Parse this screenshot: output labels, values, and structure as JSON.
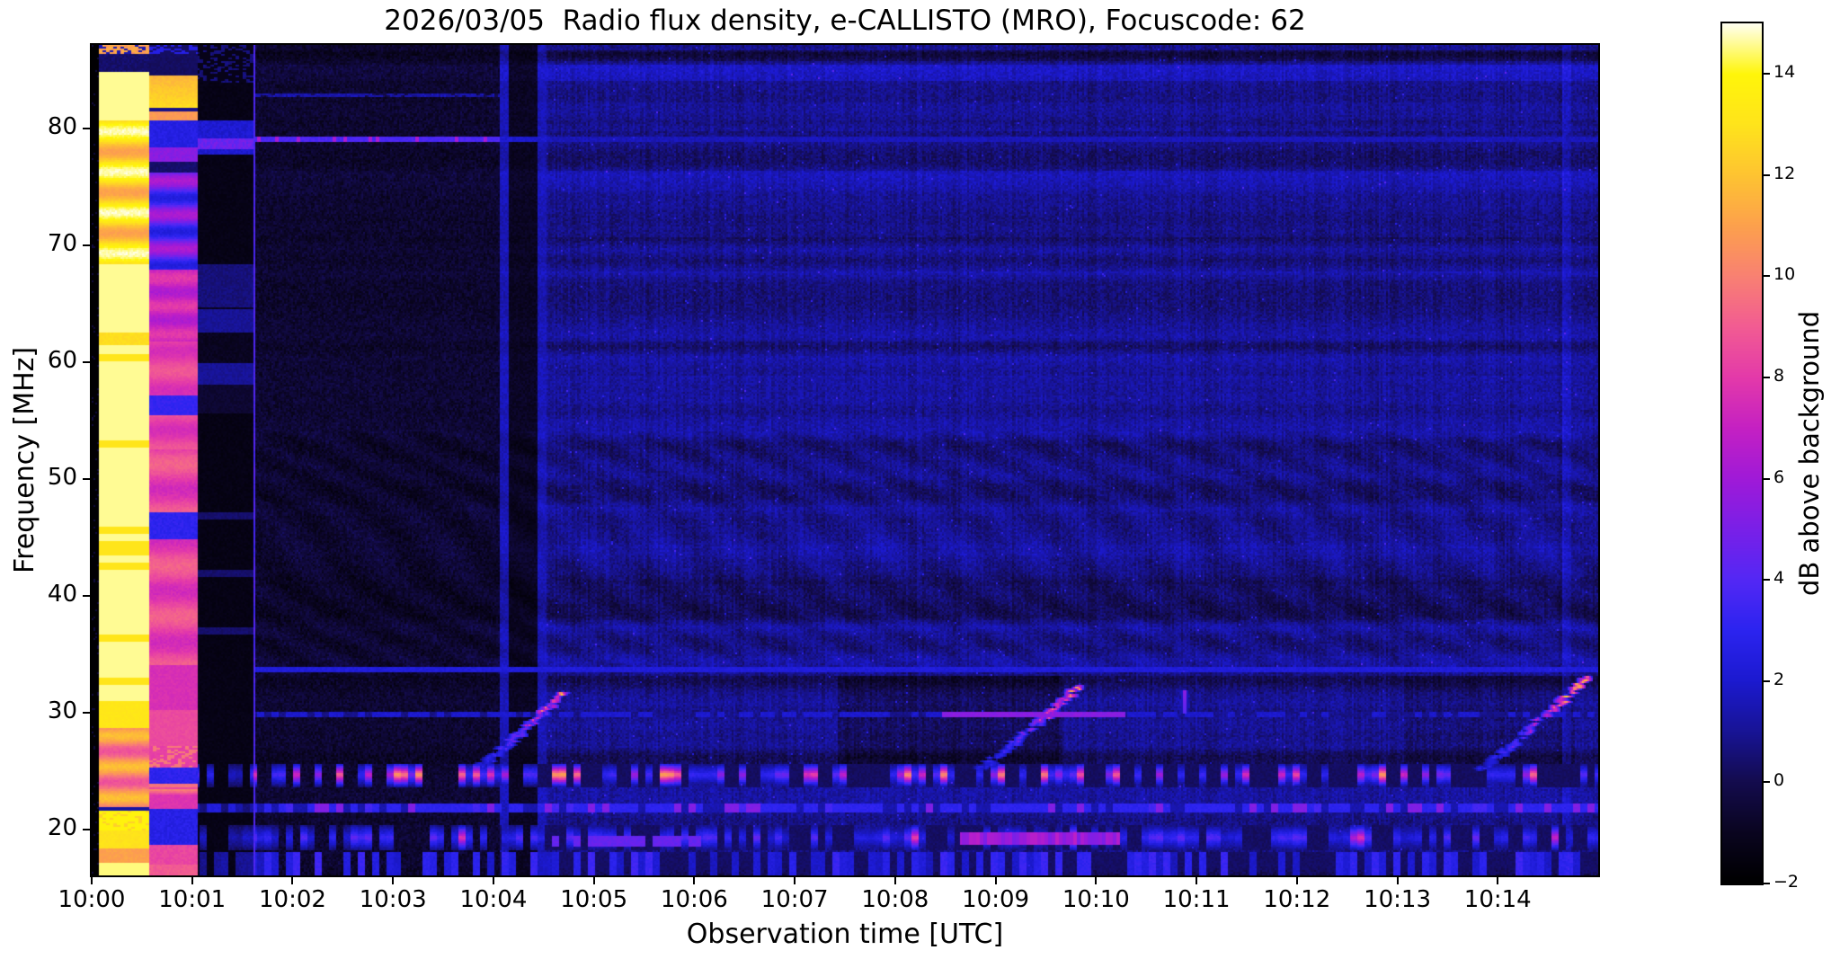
{
  "figure": {
    "background": "#ffffff"
  },
  "chart_data": {
    "type": "heatmap",
    "subtype": "solar-radio-spectrogram",
    "title": "2026/03/05  Radio flux density, e-CALLISTO (MRO), Focuscode: 62",
    "xlabel": "Observation time [UTC]",
    "ylabel": "Frequency [MHz]",
    "x_tick_labels": [
      "10:00",
      "10:01",
      "10:02",
      "10:03",
      "10:04",
      "10:05",
      "10:06",
      "10:07",
      "10:08",
      "10:09",
      "10:10",
      "10:11",
      "10:12",
      "10:13",
      "10:14"
    ],
    "x_range_utc": [
      "10:00:00",
      "10:15:00"
    ],
    "y_tick_labels": [
      "80",
      "70",
      "60",
      "50",
      "40",
      "30",
      "20"
    ],
    "y_tick_values": [
      80,
      70,
      60,
      50,
      40,
      30,
      20
    ],
    "y_range_mhz": [
      16.1,
      87.2
    ],
    "grid": false,
    "legend": "none",
    "colorbar": {
      "label": "dB above background",
      "tick_labels": [
        "14",
        "12",
        "10",
        "8",
        "6",
        "4",
        "2",
        "0",
        "−2"
      ],
      "tick_values": [
        14,
        12,
        10,
        8,
        6,
        4,
        2,
        0,
        -2
      ],
      "range_db": [
        -2,
        15
      ],
      "colormap_stops": [
        {
          "v": -2,
          "c": "#000000"
        },
        {
          "v": -1,
          "c": "#0a0520"
        },
        {
          "v": 0,
          "c": "#140c4e"
        },
        {
          "v": 1,
          "c": "#181496"
        },
        {
          "v": 2,
          "c": "#1c1ad0"
        },
        {
          "v": 3,
          "c": "#2c24f0"
        },
        {
          "v": 4,
          "c": "#5428f5"
        },
        {
          "v": 5,
          "c": "#7a20e8"
        },
        {
          "v": 6,
          "c": "#a01ad8"
        },
        {
          "v": 7,
          "c": "#c521c3"
        },
        {
          "v": 8,
          "c": "#e43aaa"
        },
        {
          "v": 9,
          "c": "#f25c93"
        },
        {
          "v": 10,
          "c": "#f98173"
        },
        {
          "v": 11,
          "c": "#fda14d"
        },
        {
          "v": 12,
          "c": "#fec432"
        },
        {
          "v": 13,
          "c": "#ffe41c"
        },
        {
          "v": 14,
          "c": "#fff60a"
        },
        {
          "v": 15,
          "c": "#fffff0"
        }
      ]
    },
    "features": {
      "startup_sequence": [
        {
          "interval_utc": [
            "10:00:00",
            "10:00:04"
          ],
          "appearance": "black gap"
        },
        {
          "interval_utc": [
            "10:00:04",
            "10:00:34"
          ],
          "appearance": "saturated white/yellow broadband column"
        },
        {
          "interval_utc": [
            "10:00:34",
            "10:01:03"
          ],
          "appearance": "magenta-pink and blue striped column"
        },
        {
          "interval_utc": [
            "10:01:03",
            "10:01:37"
          ],
          "appearance": "mostly black column with faint blue bands"
        },
        {
          "interval_utc": [
            "10:01:37",
            "10:04:05"
          ],
          "appearance": "very dark background with narrow horizontal interference stripes"
        }
      ],
      "vertical_events_utc": [
        "10:04:05",
        "10:04:32",
        "10:14:42"
      ],
      "drifting_sweeps": [
        {
          "start_utc": "10:03:50",
          "end_utc": "10:04:41",
          "f_start_mhz": 25.5,
          "f_end_mhz": 32.3,
          "peak_db": 12
        },
        {
          "start_utc": "10:08:51",
          "end_utc": "10:09:49",
          "f_start_mhz": 25.5,
          "f_end_mhz": 33.0,
          "peak_db": 12.5
        },
        {
          "start_utc": "10:13:48",
          "end_utc": "10:14:52",
          "f_start_mhz": 25.5,
          "f_end_mhz": 33.4,
          "peak_db": 15
        }
      ],
      "persistent_lines_mhz": [
        79.1,
        33.7,
        30.0
      ],
      "rfi_dash_bands_mhz": [
        [
          24.5,
          26.0
        ],
        [
          21.6,
          22.2
        ],
        [
          18.6,
          20.5
        ],
        [
          16.2,
          17.8
        ]
      ]
    }
  }
}
